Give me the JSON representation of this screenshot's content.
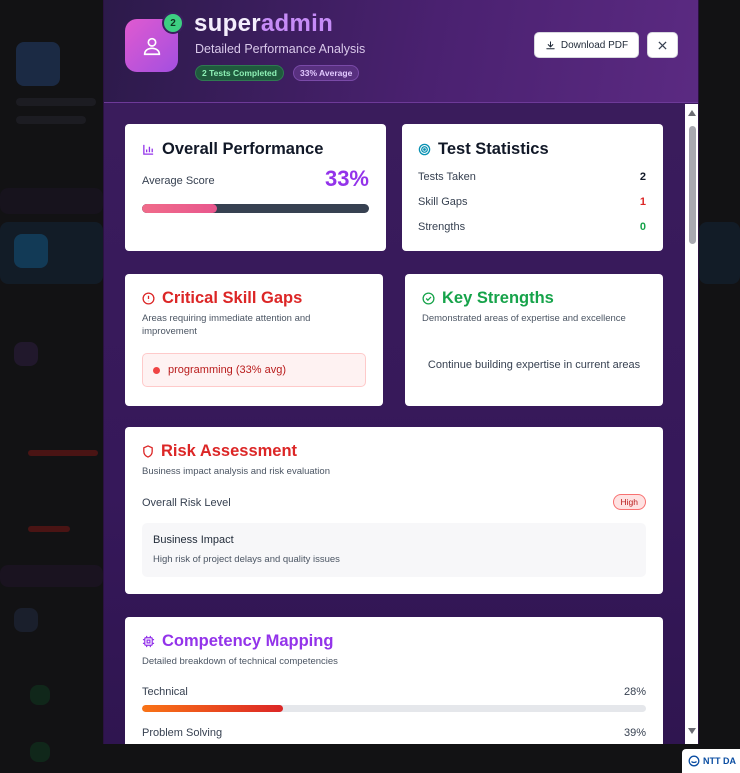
{
  "header": {
    "badge_count": "2",
    "name_part1": "super",
    "name_part2": "admin",
    "subtitle": "Detailed Performance Analysis",
    "tag_tests": "2 Tests Completed",
    "tag_average": "33% Average",
    "download_label": "Download PDF"
  },
  "overall": {
    "title": "Overall Performance",
    "score_label": "Average Score",
    "score_value": "33%",
    "progress_fraction": 0.33
  },
  "stats": {
    "title": "Test Statistics",
    "rows": [
      {
        "label": "Tests Taken",
        "value": "2",
        "color": "#111827"
      },
      {
        "label": "Skill Gaps",
        "value": "1",
        "color": "#dc2626"
      },
      {
        "label": "Strengths",
        "value": "0",
        "color": "#16a34a"
      }
    ]
  },
  "gaps": {
    "title": "Critical Skill Gaps",
    "desc": "Areas requiring immediate attention and improvement",
    "item": "programming (33% avg)"
  },
  "strengths": {
    "title": "Key Strengths",
    "desc": "Demonstrated areas of expertise and excellence",
    "empty": "Continue building expertise in current areas"
  },
  "risk": {
    "title": "Risk Assessment",
    "desc": "Business impact analysis and risk evaluation",
    "level_label": "Overall Risk Level",
    "level_value": "High",
    "impact_title": "Business Impact",
    "impact_text": "High risk of project delays and quality issues"
  },
  "competency": {
    "title": "Competency Mapping",
    "desc": "Detailed breakdown of technical competencies",
    "items": [
      {
        "label": "Technical",
        "value": "28%",
        "fraction": 0.28
      },
      {
        "label": "Problem Solving",
        "value": "39%",
        "fraction": 0.39
      }
    ]
  },
  "footer_logo": "NTT DA",
  "colors": {
    "purple": "#9333ea",
    "red": "#dc2626",
    "green": "#16a34a",
    "header_bg": "#4a2170"
  }
}
